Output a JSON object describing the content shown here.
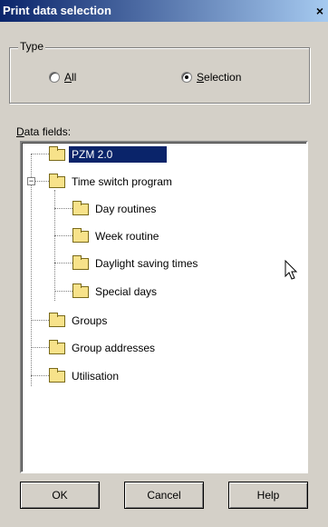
{
  "window": {
    "title": "Print data selection",
    "close_glyph": "×"
  },
  "type_group": {
    "legend": "Type",
    "options": [
      {
        "hotkey": "A",
        "rest": "ll",
        "selected": false
      },
      {
        "hotkey": "S",
        "rest": "election",
        "selected": true
      }
    ]
  },
  "data_fields": {
    "label_hotkey": "D",
    "label_rest": "ata fields:",
    "items": [
      {
        "label": "PZM 2.0",
        "selected": true
      },
      {
        "label": "Time switch program",
        "expanded": true
      },
      {
        "label": "Day routines"
      },
      {
        "label": "Week routine"
      },
      {
        "label": "Daylight saving times"
      },
      {
        "label": "Special days"
      },
      {
        "label": "Groups"
      },
      {
        "label": "Group addresses"
      },
      {
        "label": "Utilisation"
      }
    ]
  },
  "buttons": {
    "ok": "OK",
    "cancel": "Cancel",
    "help": "Help"
  },
  "expander_glyph": "−"
}
